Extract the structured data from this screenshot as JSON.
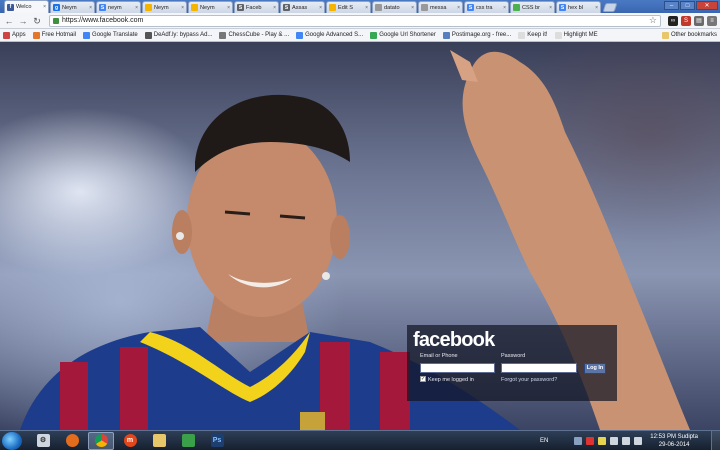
{
  "browser": {
    "tabs": [
      {
        "label": "Welco",
        "favicon": "facebook-icon",
        "color": "#3b5998",
        "letter": "f"
      },
      {
        "label": "Neym",
        "favicon": "google-icon",
        "color": "#1a73e8",
        "letter": "g"
      },
      {
        "label": "neym",
        "favicon": "google-icon",
        "color": "#4285f4",
        "letter": "S"
      },
      {
        "label": "Neym",
        "favicon": "page-icon",
        "color": "#f4b400",
        "letter": ""
      },
      {
        "label": "Neym",
        "favicon": "page-icon",
        "color": "#f4b400",
        "letter": ""
      },
      {
        "label": "Faceb",
        "favicon": "google-icon",
        "color": "#5f6368",
        "letter": "S"
      },
      {
        "label": "Assas",
        "favicon": "blogger-icon",
        "color": "#5f6368",
        "letter": "S"
      },
      {
        "label": "Edit S",
        "favicon": "page-icon",
        "color": "#f4b400",
        "letter": ""
      },
      {
        "label": "datato",
        "favicon": "page-icon",
        "color": "#999999",
        "letter": ""
      },
      {
        "label": "messa",
        "favicon": "page-icon",
        "color": "#999999",
        "letter": ""
      },
      {
        "label": "css tra",
        "favicon": "google-icon",
        "color": "#4285f4",
        "letter": "S"
      },
      {
        "label": "CSS br",
        "favicon": "page-icon",
        "color": "#4caf50",
        "letter": ""
      },
      {
        "label": "hex bl",
        "favicon": "google-icon",
        "color": "#4285f4",
        "letter": "S"
      }
    ],
    "url": "https://www.facebook.com",
    "bookmarks": [
      {
        "label": "Apps",
        "icon": "apps-icon",
        "color": "#c44"
      },
      {
        "label": "Free Hotmail",
        "icon": "windows-icon",
        "color": "#e2762b"
      },
      {
        "label": "Google Translate",
        "icon": "translate-icon",
        "color": "#4285f4"
      },
      {
        "label": "DeAdf.ly: bypass Ad...",
        "icon": "page-icon",
        "color": "#555555"
      },
      {
        "label": "ChessCube - Play & ...",
        "icon": "chess-icon",
        "color": "#777777"
      },
      {
        "label": "Google Advanced S...",
        "icon": "google-icon",
        "color": "#4285f4"
      },
      {
        "label": "Google Url Shortener",
        "icon": "google-icon",
        "color": "#34a853"
      },
      {
        "label": "Postimage.org - free...",
        "icon": "postimage-icon",
        "color": "#5a7fbf"
      },
      {
        "label": "Keep it!",
        "icon": "page-icon",
        "color": "#dddddd"
      },
      {
        "label": "Highlight ME",
        "icon": "page-icon",
        "color": "#dddddd"
      }
    ],
    "other_bookmarks": "Other bookmarks"
  },
  "login": {
    "logo": "facebook",
    "email_label": "Email or Phone",
    "password_label": "Password",
    "button": "Log In",
    "keep_logged": "Keep me logged in",
    "forgot": "Forgot your password?"
  },
  "taskbar": {
    "language": "EN",
    "time": "12:53 PM Sudipta",
    "date": "29-06-2014"
  }
}
